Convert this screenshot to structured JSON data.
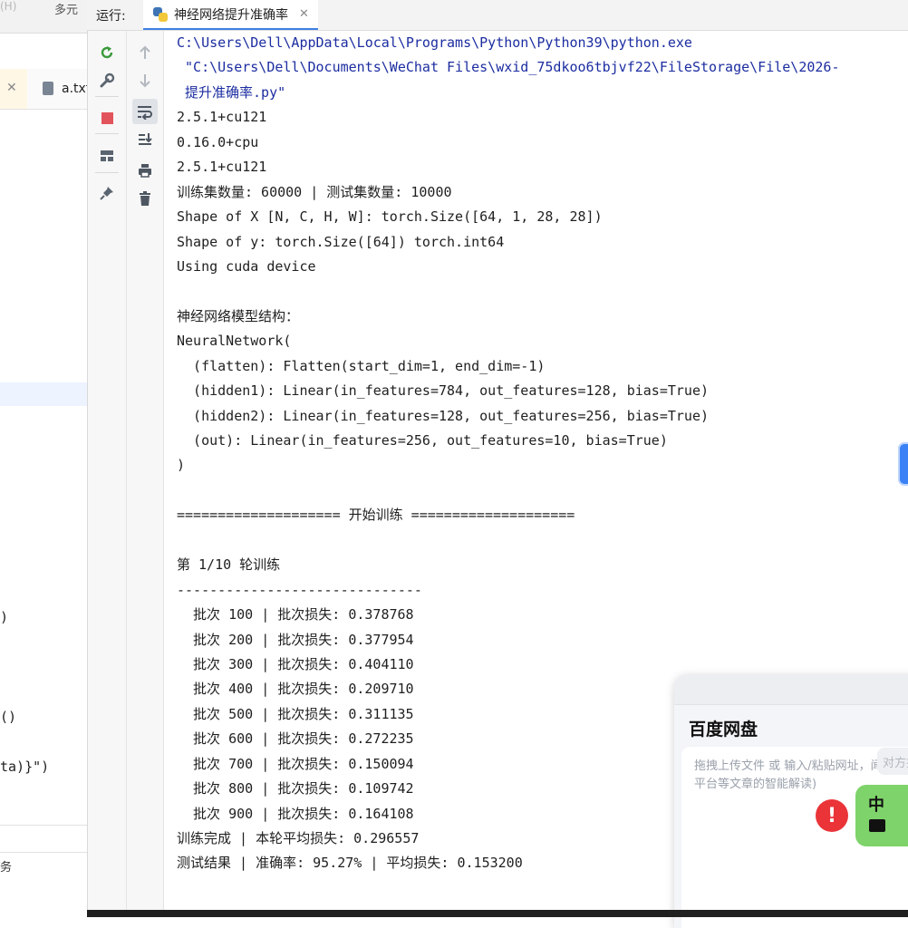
{
  "left_panel": {
    "top_text": "多元",
    "top_faded": "(H)",
    "tab_close": "✕",
    "file_name": "a.txt",
    "code_fragments": [
      ")",
      "()",
      "ta)}\")"
    ],
    "bottom_text": "务"
  },
  "run_window": {
    "label": "运行:",
    "tab_title": "神经网络提升准确率",
    "tab_close": "✕"
  },
  "toolbar": {
    "left": [
      "rerun-icon",
      "wrench-icon",
      "stop-icon",
      "layout-icon",
      "pin-icon"
    ],
    "right": [
      "arrow-up-icon",
      "arrow-down-icon",
      "soft-wrap-icon",
      "scroll-to-end-icon",
      "print-icon",
      "trash-icon"
    ]
  },
  "console": {
    "lines": [
      "C:\\Users\\Dell\\AppData\\Local\\Programs\\Python\\Python39\\python.exe",
      " \"C:\\Users\\Dell\\Documents\\WeChat Files\\wxid_75dkoo6tbjvf22\\FileStorage\\File\\2026-",
      " 提升准确率.py\"",
      "2.5.1+cu121",
      "0.16.0+cpu",
      "2.5.1+cu121",
      "训练集数量: 60000 | 测试集数量: 10000",
      "Shape of X [N, C, H, W]: torch.Size([64, 1, 28, 28])",
      "Shape of y: torch.Size([64]) torch.int64",
      "Using cuda device",
      "",
      "神经网络模型结构：",
      "NeuralNetwork(",
      "  (flatten): Flatten(start_dim=1, end_dim=-1)",
      "  (hidden1): Linear(in_features=784, out_features=128, bias=True)",
      "  (hidden2): Linear(in_features=128, out_features=256, bias=True)",
      "  (out): Linear(in_features=256, out_features=10, bias=True)",
      ")",
      "",
      "==================== 开始训练 ====================",
      "",
      "第 1/10 轮训练",
      "------------------------------",
      "  批次 100 | 批次损失: 0.378768",
      "  批次 200 | 批次损失: 0.377954",
      "  批次 300 | 批次损失: 0.404110",
      "  批次 400 | 批次损失: 0.209710",
      "  批次 500 | 批次损失: 0.311135",
      "  批次 600 | 批次损失: 0.272235",
      "  批次 700 | 批次损失: 0.150094",
      "  批次 800 | 批次损失: 0.109742",
      "  批次 900 | 批次损失: 0.164108",
      "训练完成 | 本轮平均损失: 0.296557",
      "测试结果 | 准确率: 95.27% | 平均损失: 0.153200"
    ],
    "path_color": "#1c2da1",
    "text_color": "#1f1f1f"
  },
  "baidu_popup": {
    "title": "百度网盘",
    "hint": "拖拽上传文件 或 输入/粘贴网址，闻平台等文章的智能解读)",
    "side_button": "对方推",
    "warning_symbol": "!",
    "ime_char": "中"
  }
}
